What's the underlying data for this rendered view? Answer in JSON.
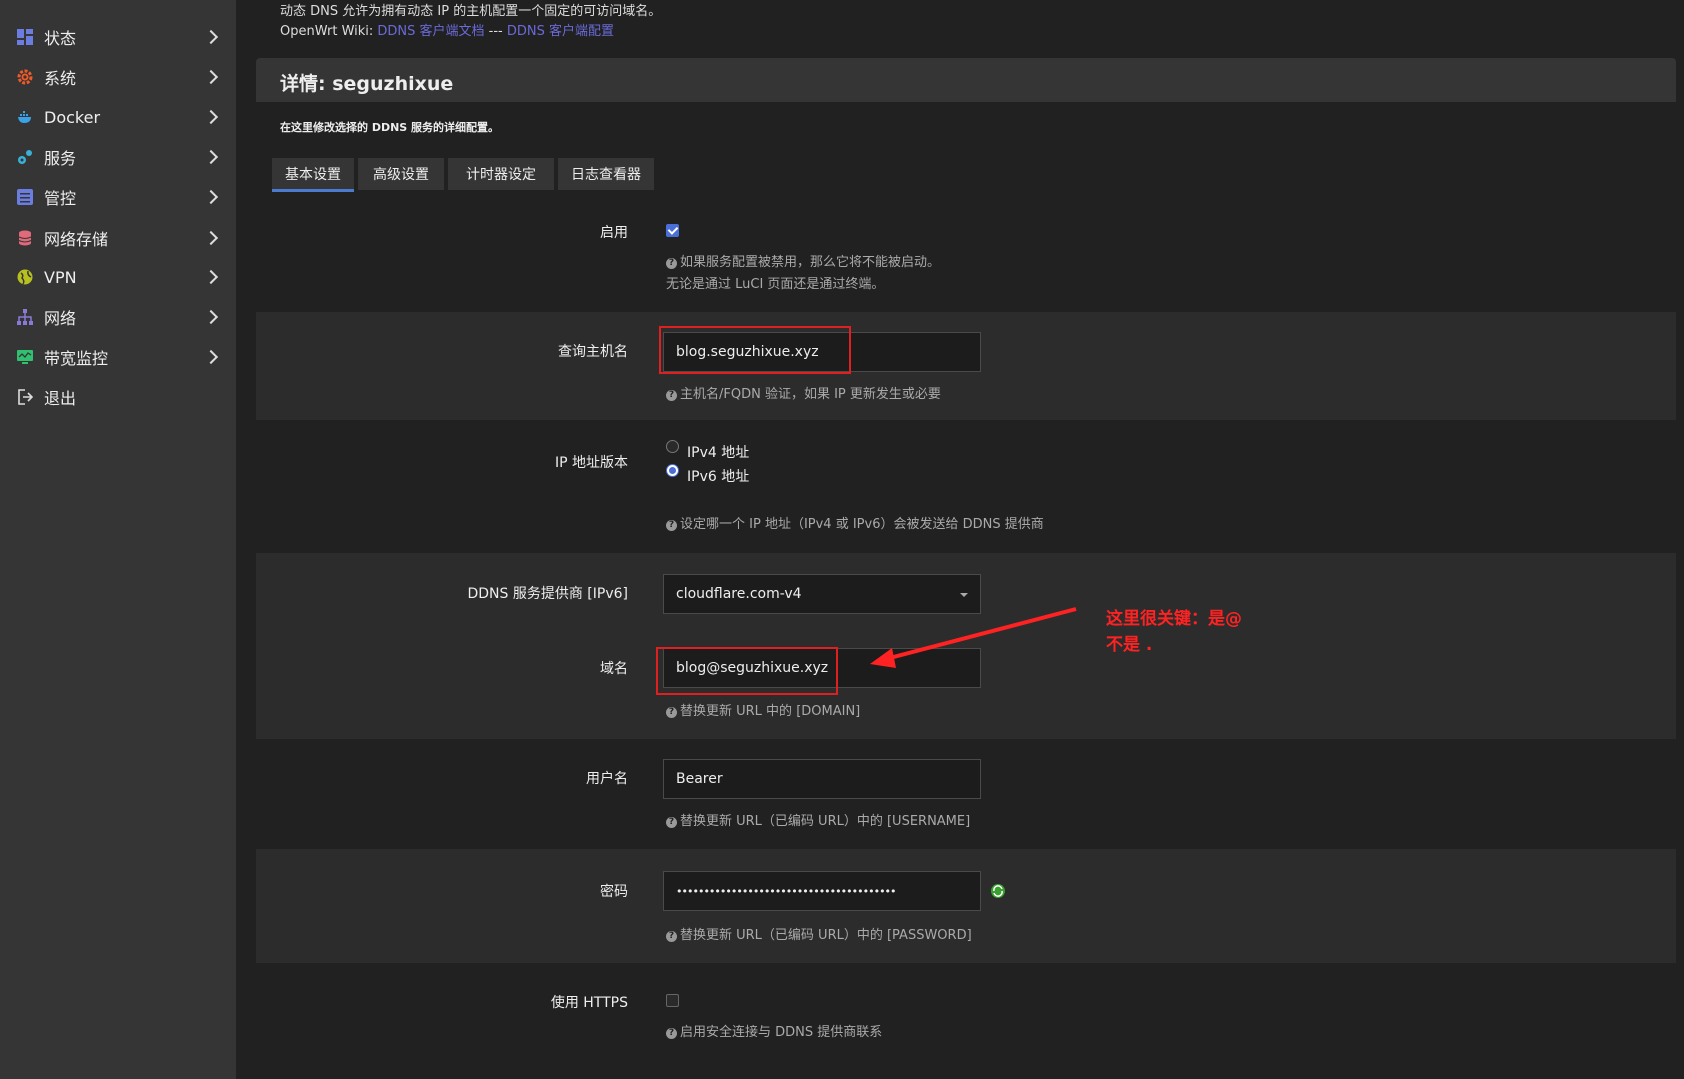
{
  "sidebar": {
    "items": [
      {
        "label": "状态",
        "icon": "dashboard-icon",
        "color": "#6b7de0"
      },
      {
        "label": "系统",
        "icon": "gear-icon",
        "color": "#f05a28"
      },
      {
        "label": "Docker",
        "icon": "docker-icon",
        "color": "#3aa3e8"
      },
      {
        "label": "服务",
        "icon": "services-icon",
        "color": "#3ab0d8"
      },
      {
        "label": "管控",
        "icon": "sliders-icon",
        "color": "#6b7de0"
      },
      {
        "label": "网络存储",
        "icon": "database-icon",
        "color": "#e06a7a"
      },
      {
        "label": "VPN",
        "icon": "globe-icon",
        "color": "#b8c020"
      },
      {
        "label": "网络",
        "icon": "network-icon",
        "color": "#8a7ad8"
      },
      {
        "label": "带宽监控",
        "icon": "monitor-icon",
        "color": "#30c070"
      },
      {
        "label": "退出",
        "icon": "logout-icon",
        "color": "#ddd"
      }
    ]
  },
  "intro": {
    "line1": "动态 DNS 允许为拥有动态 IP 的主机配置一个固定的可访问域名。",
    "wiki_prefix": "OpenWrt Wiki: ",
    "link1": "DDNS 客户端文档",
    "separator": " --- ",
    "link2": "DDNS 客户端配置"
  },
  "panel": {
    "title": "详情: seguzhixue",
    "description": "在这里修改选择的 DDNS 服务的详细配置。"
  },
  "tabs": [
    {
      "label": "基本设置",
      "active": true
    },
    {
      "label": "高级设置",
      "active": false
    },
    {
      "label": "计时器设定",
      "active": false
    },
    {
      "label": "日志查看器",
      "active": false
    }
  ],
  "form": {
    "enable": {
      "label": "启用",
      "checked": true,
      "help1": "如果服务配置被禁用，那么它将不能被启动。",
      "help2": "无论是通过 LuCI 页面还是通过终端。"
    },
    "lookup_host": {
      "label": "查询主机名",
      "value": "blog.seguzhixue.xyz",
      "help": "主机名/FQDN 验证，如果 IP 更新发生或必要"
    },
    "ip_version": {
      "label": "IP 地址版本",
      "options": [
        "IPv4 地址",
        "IPv6 地址"
      ],
      "selected": "IPv6 地址",
      "help": "设定哪一个 IP 地址（IPv4 或 IPv6）会被发送给 DDNS 提供商"
    },
    "provider": {
      "label": "DDNS 服务提供商 [IPv6]",
      "value": "cloudflare.com-v4"
    },
    "domain": {
      "label": "域名",
      "value": "blog@seguzhixue.xyz",
      "help": "替换更新 URL 中的 [DOMAIN]"
    },
    "username": {
      "label": "用户名",
      "value": "Bearer",
      "help": "替换更新 URL（已编码 URL）中的 [USERNAME]"
    },
    "password": {
      "label": "密码",
      "value": "••••••••••••••••••••••••••••••••••••••••",
      "help": "替换更新 URL（已编码 URL）中的 [PASSWORD]"
    },
    "https": {
      "label": "使用 HTTPS",
      "checked": false,
      "help": "启用安全连接与 DDNS 提供商联系"
    }
  },
  "annotation": {
    "line1": "这里很关键：是@",
    "line2": "不是 .",
    "color": "#ff2222"
  },
  "colors": {
    "accent": "#4a6fd8",
    "sidebar_bg": "#353535",
    "page_bg": "#212121"
  }
}
